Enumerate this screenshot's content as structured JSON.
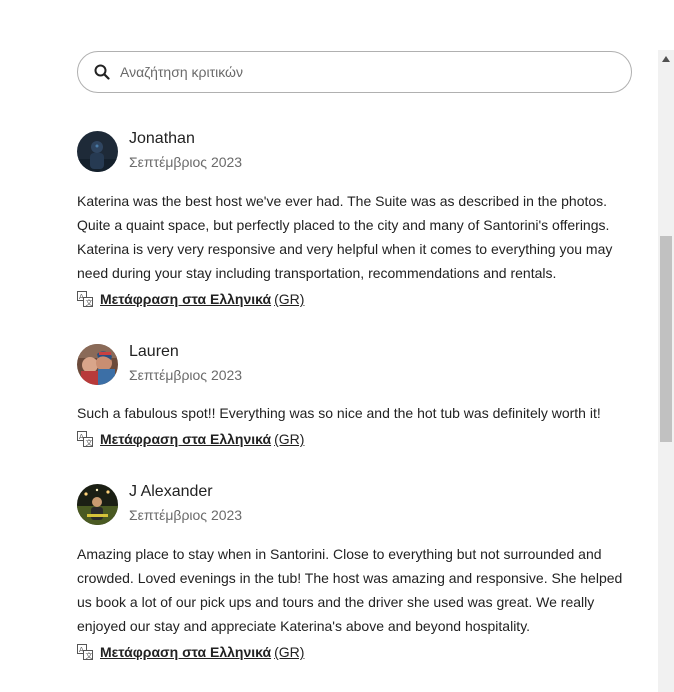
{
  "search": {
    "placeholder": "Αναζήτηση κριτικών",
    "icon": "search-icon"
  },
  "reviews": [
    {
      "name": "Jonathan",
      "date": "Σεπτέμβριος 2023",
      "avatar": "avatar-jonathan",
      "lines": [
        "Katerina was the best host we've ever had. The Suite was as described in the photos.",
        "Quite a quaint space, but perfectly placed to the city and many of Santorini's offerings.",
        "Katerina is very very responsive and very helpful when it comes to everything you may",
        "need during your stay including transportation, recommendations and rentals."
      ],
      "translate_label": "Μετάφραση στα Ελληνικά",
      "translate_code": "(GR)"
    },
    {
      "name": "Lauren",
      "date": "Σεπτέμβριος 2023",
      "avatar": "avatar-lauren",
      "lines": [
        "Such a fabulous spot!! Everything was so nice and the hot tub was definitely worth it!"
      ],
      "translate_label": "Μετάφραση στα Ελληνικά",
      "translate_code": "(GR)"
    },
    {
      "name": "J Alexander",
      "date": "Σεπτέμβριος 2023",
      "avatar": "avatar-j-alexander",
      "lines": [
        "Amazing place to stay when in Santorini. Close to everything but not surrounded and",
        "crowded. Loved evenings in the tub! The host was amazing and responsive. She helped",
        "us book a lot of our pick ups and tours and the driver she used was great. We really",
        "enjoyed our stay and appreciate Katerina's above and beyond hospitality."
      ],
      "translate_label": "Μετάφραση στα Ελληνικά",
      "translate_code": "(GR)"
    }
  ],
  "icons": {
    "translate": "translate-icon",
    "scroll_up": "chevron-up-icon"
  }
}
